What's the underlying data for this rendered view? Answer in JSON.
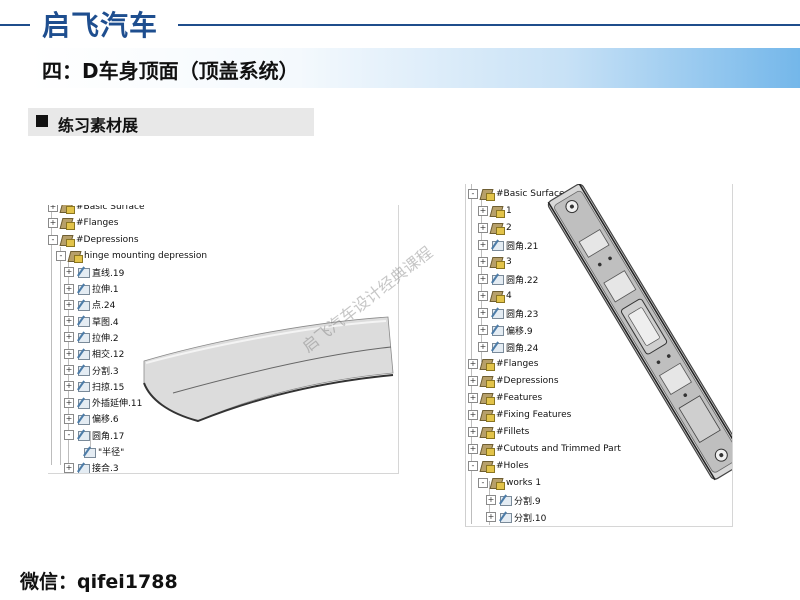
{
  "brand": "启飞汽车",
  "section_title": "四：D车身顶面（顶盖系统）",
  "subsection_title": "练习素材展",
  "left_tree": [
    {
      "label": "#Basic Surface",
      "icon": "surface-set-icon",
      "toggle": "+"
    },
    {
      "label": "#Flanges",
      "icon": "surface-set-icon",
      "toggle": "+"
    },
    {
      "label": "#Depressions",
      "icon": "surface-set-icon",
      "toggle": "-"
    },
    {
      "label": "hinge mounting depression",
      "icon": "surface-set-icon",
      "toggle": "-"
    },
    {
      "label": "直线.19",
      "icon": "line-icon",
      "toggle": "+"
    },
    {
      "label": "拉伸.1",
      "icon": "extrude-icon",
      "toggle": "+"
    },
    {
      "label": "点.24",
      "icon": "point-icon",
      "toggle": "+"
    },
    {
      "label": "草图.4",
      "icon": "sketch-icon",
      "toggle": "+"
    },
    {
      "label": "拉伸.2",
      "icon": "extrude-icon",
      "toggle": "+"
    },
    {
      "label": "相交.12",
      "icon": "intersect-icon",
      "toggle": "+"
    },
    {
      "label": "分割.3",
      "icon": "split-icon",
      "toggle": "+"
    },
    {
      "label": "扫掠.15",
      "icon": "sweep-icon",
      "toggle": "+"
    },
    {
      "label": "外插延伸.11",
      "icon": "extrapolate-icon",
      "toggle": "+"
    },
    {
      "label": "偏移.6",
      "icon": "offset-icon",
      "toggle": "+"
    },
    {
      "label": "圆角.17",
      "icon": "fillet-icon",
      "toggle": "-"
    },
    {
      "label": "\"半径\"",
      "icon": "parameter-icon",
      "toggle": ""
    },
    {
      "label": "接合.3",
      "icon": "join-icon",
      "toggle": "+"
    }
  ],
  "right_tree": [
    {
      "label": "#Basic Surface",
      "icon": "surface-set-icon",
      "toggle": "-"
    },
    {
      "label": "1",
      "icon": "surface-set-icon",
      "toggle": "+"
    },
    {
      "label": "2",
      "icon": "surface-set-icon",
      "toggle": "+"
    },
    {
      "label": "圆角.21",
      "icon": "fillet-icon",
      "toggle": "+"
    },
    {
      "label": "3",
      "icon": "surface-set-icon",
      "toggle": "+"
    },
    {
      "label": "圆角.22",
      "icon": "fillet-icon",
      "toggle": "+"
    },
    {
      "label": "4",
      "icon": "surface-set-icon",
      "toggle": "+"
    },
    {
      "label": "圆角.23",
      "icon": "fillet-icon",
      "toggle": "+"
    },
    {
      "label": "偏移.9",
      "icon": "offset-icon",
      "toggle": "+"
    },
    {
      "label": "圆角.24",
      "icon": "fillet-icon",
      "toggle": "+"
    },
    {
      "label": "#Flanges",
      "icon": "surface-set-icon",
      "toggle": "+"
    },
    {
      "label": "#Depressions",
      "icon": "surface-set-icon",
      "toggle": "+"
    },
    {
      "label": "#Features",
      "icon": "surface-set-icon",
      "toggle": "+"
    },
    {
      "label": "#Fixing Features",
      "icon": "surface-set-icon",
      "toggle": "+"
    },
    {
      "label": "#Fillets",
      "icon": "surface-set-icon",
      "toggle": "+"
    },
    {
      "label": "#Cutouts and Trimmed Part",
      "icon": "surface-set-icon",
      "toggle": "+"
    },
    {
      "label": "#Holes",
      "icon": "surface-set-icon",
      "toggle": "-"
    },
    {
      "label": "works 1",
      "icon": "surface-set-icon",
      "toggle": "-"
    },
    {
      "label": "分割.9",
      "icon": "split-icon",
      "toggle": "+"
    },
    {
      "label": "分割.10",
      "icon": "split-icon",
      "toggle": "+"
    }
  ],
  "watermark": "启飞汽车设计经典课程",
  "footer": "微信：qifei1788",
  "colors": {
    "brand": "#1e4e8f",
    "section_gradient_end": "#74b7ea",
    "part_surface": "#d9d9d9"
  }
}
